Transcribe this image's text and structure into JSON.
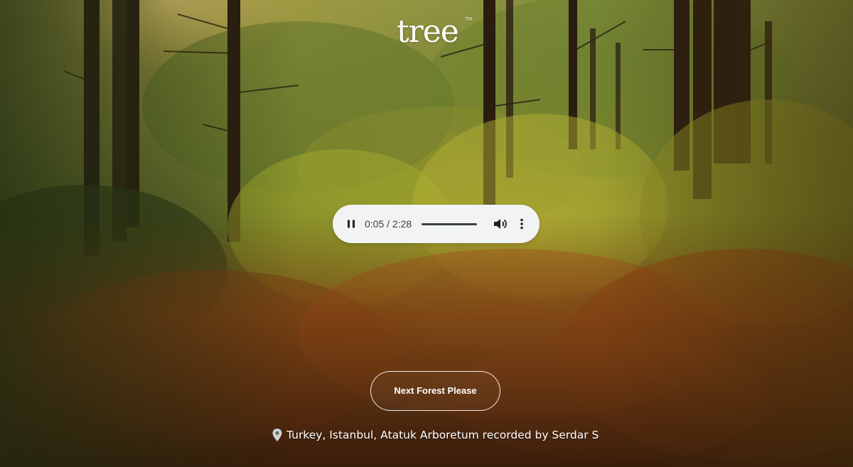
{
  "brand": {
    "logo_text": "tree",
    "trademark": "TM"
  },
  "audio_player": {
    "current_time": "0:05",
    "duration": "2:28",
    "progress_fraction": 1.0,
    "state": "playing",
    "pause_icon": "pause-icon",
    "volume_icon": "volume-icon",
    "more_icon": "more-vertical-icon"
  },
  "actions": {
    "next_label": "Next Forest Please"
  },
  "recording": {
    "location_icon": "map-pin-icon",
    "caption": "Turkey, Istanbul, Atatuk Arboretum recorded by Serdar S"
  },
  "colors": {
    "player_bg": "#f1f3f4",
    "player_text": "#3c4043",
    "text_light": "#ffffff"
  }
}
